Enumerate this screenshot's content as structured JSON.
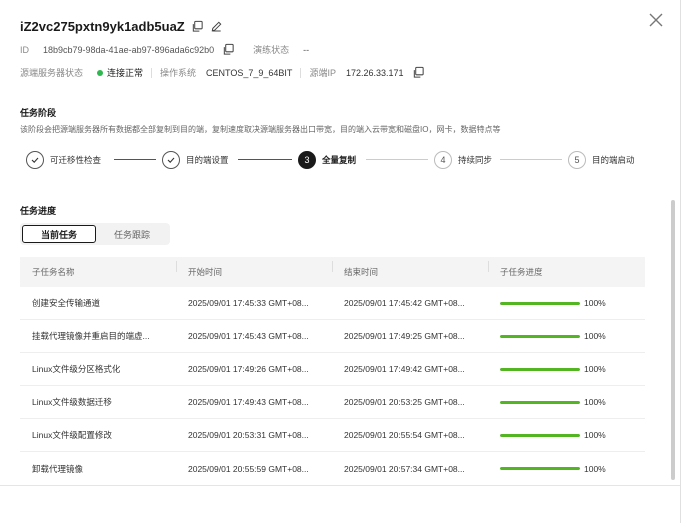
{
  "header": {
    "title": "iZ2vc275pxtn9yk1adb5uaZ",
    "id_label": "ID",
    "id_value": "18b9cb79-98da-41ae-ab97-896ada6c92b0",
    "drill_label": "演练状态",
    "drill_value": "--",
    "source_status_label": "源端服务器状态",
    "source_status_value": "连接正常",
    "os_label": "操作系统",
    "os_value": "CENTOS_7_9_64BIT",
    "ip_label": "源端IP",
    "ip_value": "172.26.33.171"
  },
  "stage": {
    "title": "任务阶段",
    "description": "该阶段会把源端服务器所有数据都全部复制到目的端，复制速度取决源端服务器出口带宽，目的端入云带宽和磁盘IO，网卡，数据特点等",
    "steps": [
      {
        "num": "1",
        "label": "可迁移性检查",
        "state": "done"
      },
      {
        "num": "2",
        "label": "目的端设置",
        "state": "done"
      },
      {
        "num": "3",
        "label": "全量复制",
        "state": "active"
      },
      {
        "num": "4",
        "label": "持续同步",
        "state": "future"
      },
      {
        "num": "5",
        "label": "目的端启动",
        "state": "future"
      }
    ]
  },
  "progress": {
    "title": "任务进度",
    "tabs": [
      "当前任务",
      "任务跟踪"
    ],
    "columns": [
      "子任务名称",
      "开始时间",
      "结束时间",
      "子任务进度"
    ],
    "rows": [
      {
        "name": "创建安全传输通道",
        "start": "2025/09/01 17:45:33 GMT+08...",
        "end": "2025/09/01 17:45:42 GMT+08...",
        "progress": 100,
        "pct": "100%"
      },
      {
        "name": "挂载代理镜像并重启目的端虚...",
        "start": "2025/09/01 17:45:43 GMT+08...",
        "end": "2025/09/01 17:49:25 GMT+08...",
        "progress": 100,
        "pct": "100%"
      },
      {
        "name": "Linux文件级分区格式化",
        "start": "2025/09/01 17:49:26 GMT+08...",
        "end": "2025/09/01 17:49:42 GMT+08...",
        "progress": 100,
        "pct": "100%"
      },
      {
        "name": "Linux文件级数据迁移",
        "start": "2025/09/01 17:49:43 GMT+08...",
        "end": "2025/09/01 20:53:25 GMT+08...",
        "progress": 100,
        "pct": "100%"
      },
      {
        "name": "Linux文件级配置修改",
        "start": "2025/09/01 20:53:31 GMT+08...",
        "end": "2025/09/01 20:55:54 GMT+08...",
        "progress": 100,
        "pct": "100%"
      },
      {
        "name": "卸载代理镜像",
        "start": "2025/09/01 20:55:59 GMT+08...",
        "end": "2025/09/01 20:57:34 GMT+08...",
        "progress": 100,
        "pct": "100%"
      }
    ]
  },
  "colors": {
    "accent": "#1a1a1a",
    "success": "#2fb84f",
    "progress_fill": "#53b521"
  }
}
